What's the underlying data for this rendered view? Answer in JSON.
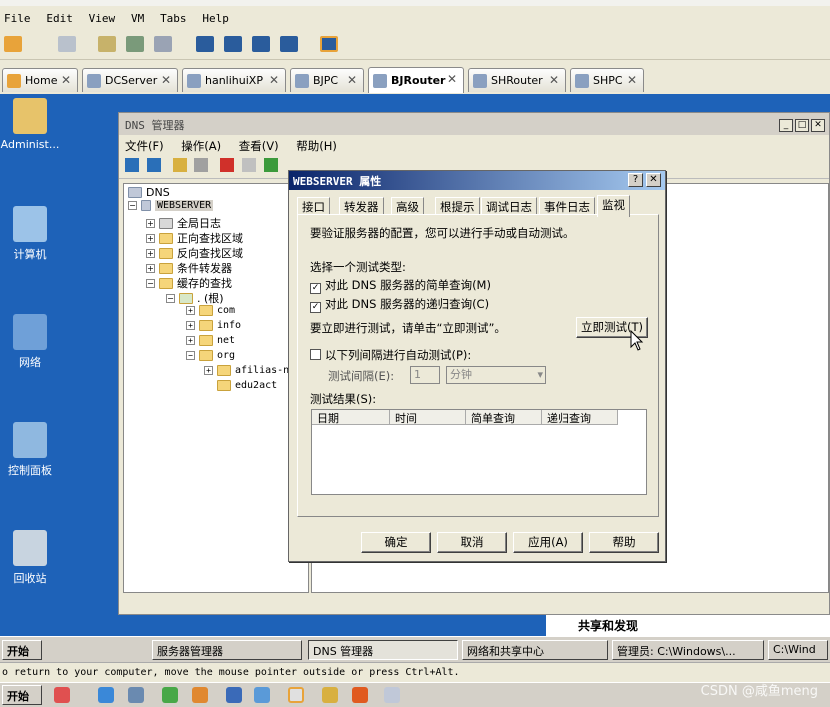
{
  "vm_menu": [
    "File",
    "Edit",
    "View",
    "VM",
    "Tabs",
    "Help"
  ],
  "tabs": [
    {
      "label": "Home"
    },
    {
      "label": "DCServer"
    },
    {
      "label": "hanlihuiXP"
    },
    {
      "label": "BJPC"
    },
    {
      "label": "BJRouter"
    },
    {
      "label": "SHRouter"
    },
    {
      "label": "SHPC"
    }
  ],
  "desktop_icons": [
    "Administ...",
    "计算机",
    "网络",
    "控制面板",
    "回收站"
  ],
  "dns_window": {
    "title": "DNS 管理器",
    "menu": [
      "文件(F)",
      "操作(A)",
      "查看(V)",
      "帮助(H)"
    ],
    "tree": {
      "root": "DNS",
      "server": "WEBSERVER",
      "items": [
        "全局日志",
        "正向查找区域",
        "反向查找区域",
        "条件转发器",
        "缓存的查找"
      ],
      "cache_root": ". (根)",
      "cache_children": [
        "com",
        "info",
        "net",
        "org"
      ],
      "org_children": [
        "afilias-ns",
        "edu2act"
      ]
    },
    "footer_text": "共享和发现"
  },
  "dialog": {
    "title": "WEBSERVER 属性",
    "tabs": [
      "接口",
      "转发器",
      "高级",
      "根提示",
      "调试日志",
      "事件日志",
      "监视"
    ],
    "active_tab": "监视",
    "intro": "要验证服务器的配置，您可以进行手动或自动测试。",
    "select_label": "选择一个测试类型:",
    "simple_query": "对此 DNS 服务器的简单查询(M)",
    "recursive_query": "对此 DNS 服务器的递归查询(C)",
    "test_prompt": "要立即进行测试，请单击“立即测试”。",
    "test_now": "立即测试(T)",
    "auto_test": "以下列间隔进行自动测试(P):",
    "interval_label": "测试间隔(E):",
    "interval_value": "1",
    "interval_unit": "分钟",
    "results_label": "测试结果(S):",
    "columns": [
      "日期",
      "时间",
      "简单查询",
      "递归查询"
    ],
    "buttons": [
      "确定",
      "取消",
      "应用(A)",
      "帮助"
    ]
  },
  "taskbar": {
    "start": "开始",
    "items": [
      "服务器管理器",
      "DNS 管理器",
      "网络和共享中心",
      "管理员: C:\\Windows\\...",
      "C:\\Wind"
    ]
  },
  "status_text": "o return to your computer, move the mouse pointer outside or press Ctrl+Alt.",
  "taskbar2_start": "开始",
  "watermark": "CSDN @咸鱼meng"
}
